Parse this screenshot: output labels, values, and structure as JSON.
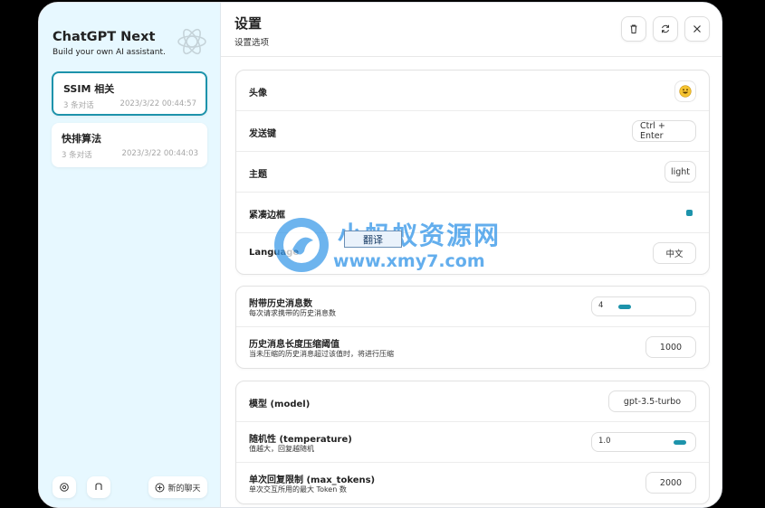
{
  "brand": {
    "title": "ChatGPT Next",
    "subtitle": "Build your own AI assistant."
  },
  "chats": [
    {
      "title": "SSIM 相关",
      "count": "3 条对话",
      "date": "2023/3/22 00:44:57",
      "active": true
    },
    {
      "title": "快排算法",
      "count": "3 条对话",
      "date": "2023/3/22 00:44:03",
      "active": false
    }
  ],
  "sidebar_footer": {
    "new_chat_label": "新的聊天"
  },
  "header": {
    "title": "设置",
    "subtitle": "设置选项"
  },
  "settings_group1": {
    "avatar_label": "头像",
    "avatar_icon": "grinning-emoji",
    "send_key_label": "发送键",
    "send_key_value": "Ctrl + Enter",
    "theme_label": "主题",
    "theme_value": "light",
    "compact_label": "紧凑边框",
    "compact_checked": true,
    "language_label": "Language",
    "language_value": "中文"
  },
  "settings_group2": {
    "history_count_label": "附带历史消息数",
    "history_count_desc": "每次请求携带的历史消息数",
    "history_count_value": "4",
    "history_count_fraction": 0.1,
    "compress_label": "历史消息长度压缩阈值",
    "compress_desc": "当未压缩的历史消息超过该值时，将进行压缩",
    "compress_value": "1000"
  },
  "settings_group3": {
    "model_label": "模型 (model)",
    "model_value": "gpt-3.5-turbo",
    "temperature_label": "随机性 (temperature)",
    "temperature_desc": "值越大，回复越随机",
    "temperature_value": "1.0",
    "temperature_fraction": 1.0,
    "max_tokens_label": "单次回复限制 (max_tokens)",
    "max_tokens_desc": "单次交互所用的最大 Token 数",
    "max_tokens_value": "2000"
  },
  "watermark": {
    "text": "小蚂蚁资源网",
    "url": "www.xmy7.com"
  },
  "translate_popup": {
    "label": "翻译"
  },
  "colors": {
    "accent": "#1d93ab",
    "sidebar_bg": "#e7f8ff",
    "watermark": "#3d9be9"
  }
}
